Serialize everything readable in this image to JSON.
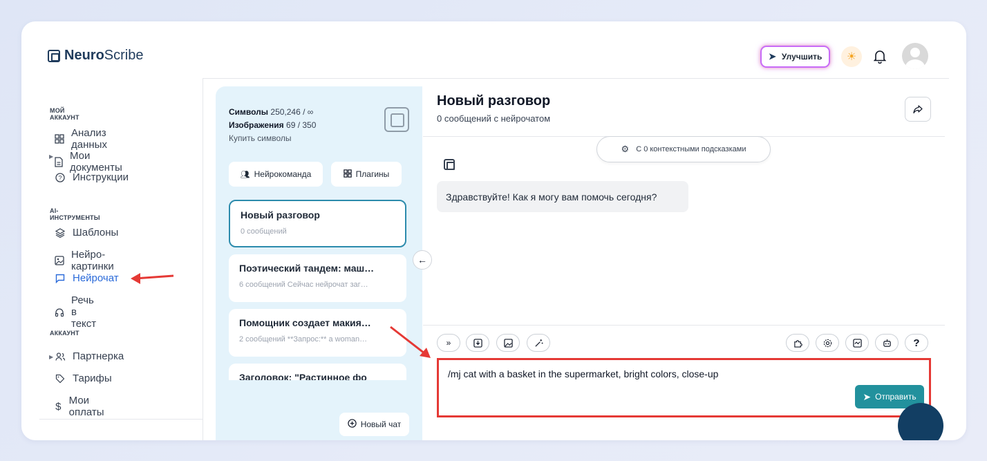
{
  "header": {
    "logo_bold": "Neuro",
    "logo_rest": "Scribe",
    "upgrade_label": "Улучшить"
  },
  "sidebar": {
    "section_account": "МОЙ АККАУНТ",
    "section_ai": "AI-ИНСТРУМЕНТЫ",
    "section_acc2": "АККАУНТ",
    "items": [
      {
        "label": "Анализ данных",
        "icon": "grid-icon"
      },
      {
        "label": "Мои документы",
        "icon": "document-icon"
      },
      {
        "label": "Инструкции",
        "icon": "help-circle-icon"
      },
      {
        "label": "Шаблоны",
        "icon": "layers-icon"
      },
      {
        "label": "Нейро-картинки",
        "icon": "image-icon"
      },
      {
        "label": "Нейрочат",
        "icon": "chat-icon"
      },
      {
        "label": "Речь в текст",
        "icon": "headphones-icon"
      },
      {
        "label": "Партнерка",
        "icon": "users-icon"
      },
      {
        "label": "Тарифы",
        "icon": "tag-icon"
      },
      {
        "label": "Мои оплаты",
        "icon": "dollar-icon"
      }
    ]
  },
  "panel": {
    "symbols_label": "Символы",
    "symbols_value": "250,246 / ∞",
    "images_label": "Изображения",
    "images_value": "69 / 350",
    "buy_label": "Купить символы",
    "team_label": "Нейрокоманда",
    "plugins_label": "Плагины",
    "new_chat_label": "Новый чат",
    "chats": [
      {
        "title": "Новый разговор",
        "meta": "0 сообщений"
      },
      {
        "title": "Поэтический тандем: маш…",
        "meta": "6 сообщений   Сейчас нейрочат заг…"
      },
      {
        "title": "Помощник создает макия…",
        "meta": "2 сообщений   **Запрос:** a woman…"
      },
      {
        "title": "Заголовок: \"Растинное фо",
        "meta": ""
      }
    ]
  },
  "main": {
    "title": "Новый разговор",
    "subtitle": "0 сообщений с нейрочатом",
    "context_label": "С 0 контекстными подсказками",
    "greeting": "Здравствуйте! Как я могу вам помочь сегодня?",
    "input_value": "/mj cat with a basket in the supermarket, bright colors, close-up",
    "send_label": "Отправить"
  },
  "colors": {
    "accent": "#2a6ad9",
    "send": "#22919d",
    "highlight": "#e53935",
    "panel_bg": "#e4f3fb"
  }
}
